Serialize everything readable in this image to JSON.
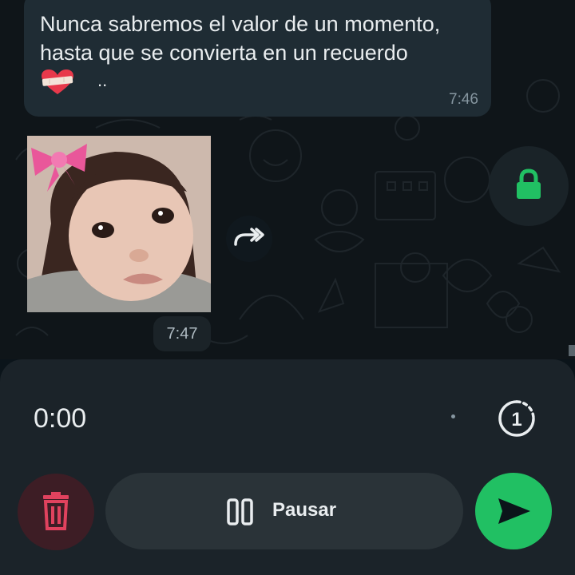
{
  "message": {
    "text_line1": "Nunca sabremos el valor de un momento,",
    "text_line2": "hasta que se convierta en un recuerdo",
    "emoji": "mending-heart-emoji",
    "trailing": "..",
    "time": "7:46"
  },
  "sticker": {
    "time": "7:47"
  },
  "recorder": {
    "timer": "0:00",
    "pause_label": "Pausar",
    "view_once_number": "1"
  },
  "colors": {
    "accent": "#21c063",
    "delete_bg": "#3d1d25",
    "delete_icon": "#e0425e",
    "bubble": "#1f2c34",
    "panel": "#1b2329"
  },
  "icons": {
    "lock": "lock-icon",
    "forward": "forward-icon",
    "delete": "trash-icon",
    "pause": "pause-icon",
    "send": "send-icon",
    "view_once": "view-once-icon"
  }
}
